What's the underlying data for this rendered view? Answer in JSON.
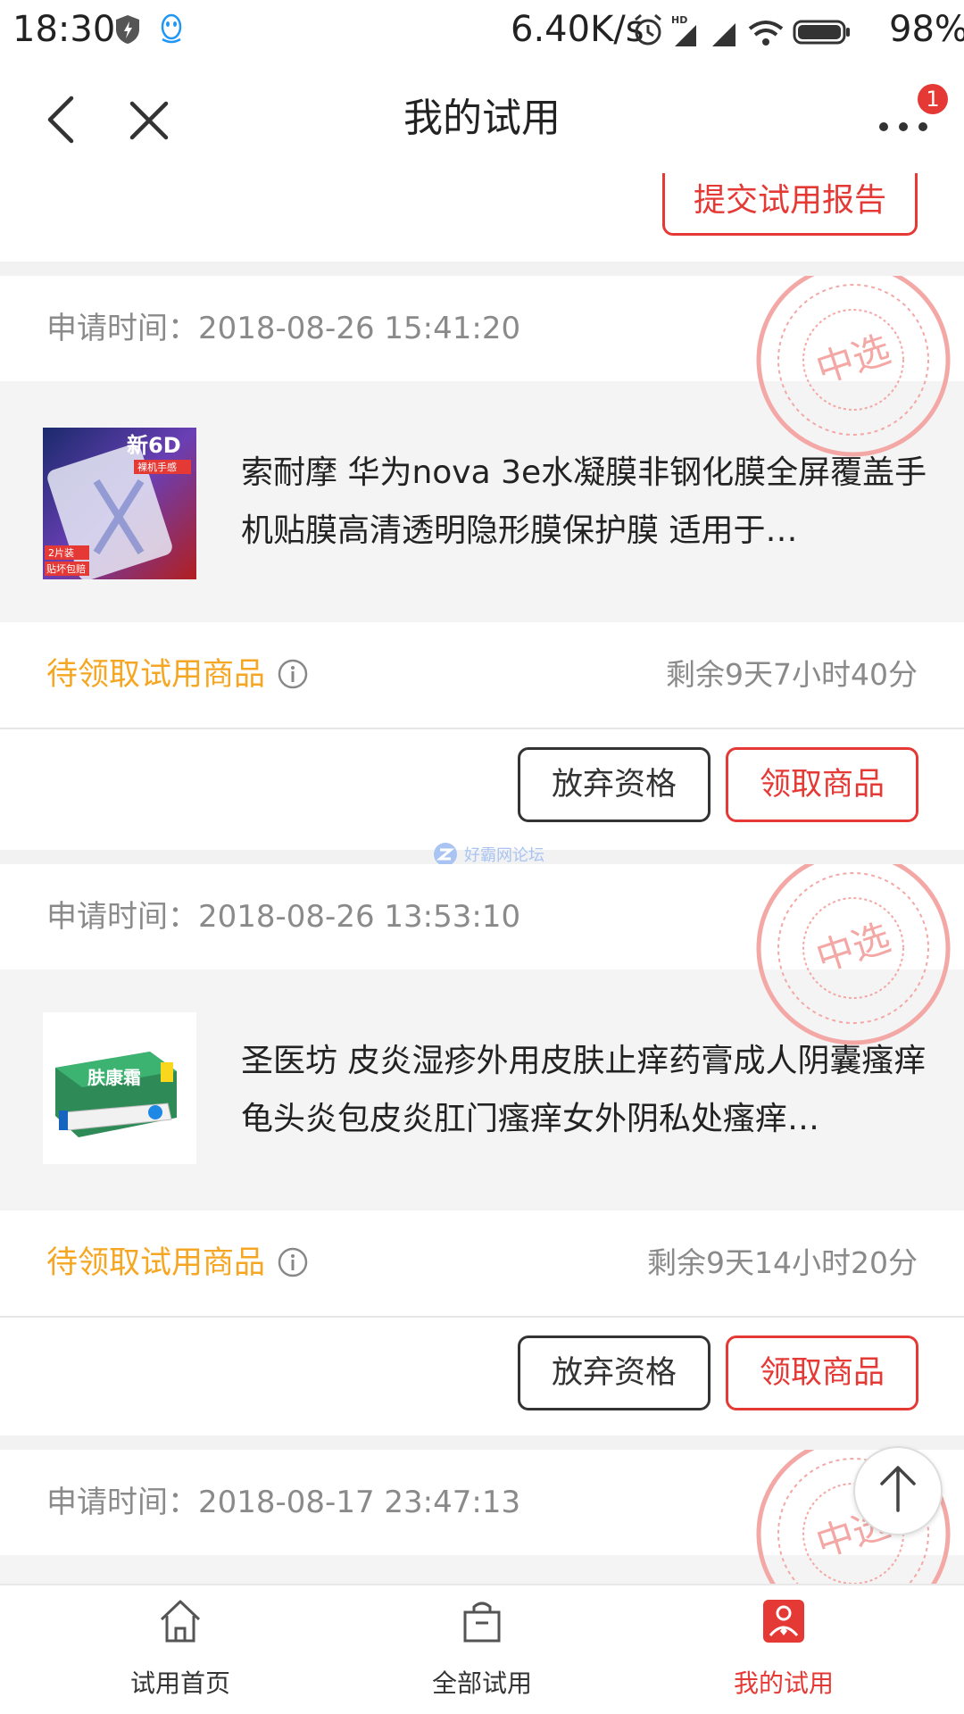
{
  "status_bar": {
    "time": "18:30",
    "network_speed": "6.40K/s",
    "battery_percent": "98%",
    "icons": [
      "shield-icon",
      "qq-icon",
      "alarm-icon",
      "hd-signal-icon",
      "signal-icon",
      "wifi-icon",
      "battery-icon"
    ]
  },
  "nav": {
    "title": "我的试用",
    "badge_count": "1",
    "icons": [
      "back-icon",
      "close-icon",
      "more-icon"
    ]
  },
  "report_button": "提交试用报告",
  "cards": [
    {
      "apply_time": "申请时间：2018-08-26 15:41:20",
      "stamp": "中选",
      "product_title": "索耐摩 华为nova 3e水凝膜非钢化膜全屏覆盖手机贴膜高清透明隐形膜保护膜 适用于…",
      "thumb_text": {
        "main": "新6D",
        "sub": "裸机手感",
        "pack": "2片装",
        "note": "贴坏包赔"
      },
      "status": "待领取试用商品",
      "remaining": "剩余9天7小时40分",
      "abandon": "放弃资格",
      "claim": "领取商品"
    },
    {
      "apply_time": "申请时间：2018-08-26 13:53:10",
      "stamp": "中选",
      "product_title": "圣医坊 皮炎湿疹外用皮肤止痒药膏成人阴囊瘙痒龟头炎包皮炎肛门瘙痒女外阴私处瘙痒…",
      "thumb_text": {
        "main": "肤康霜"
      },
      "status": "待领取试用商品",
      "remaining": "剩余9天14小时20分",
      "abandon": "放弃资格",
      "claim": "领取商品"
    },
    {
      "apply_time": "申请时间：2018-08-17 23:47:13",
      "stamp": "中选"
    }
  ],
  "watermark": "好霸网论坛",
  "tab_bar": [
    {
      "label": "试用首页",
      "icon": "home-icon",
      "active": false
    },
    {
      "label": "全部试用",
      "icon": "bag-icon",
      "active": false
    },
    {
      "label": "我的试用",
      "icon": "my-trial-icon",
      "active": true
    }
  ],
  "colors": {
    "accent_red": "#e53935",
    "status_orange": "#f5a623",
    "text_gray": "#8a8a8a",
    "separator": "#f2f2f2"
  }
}
